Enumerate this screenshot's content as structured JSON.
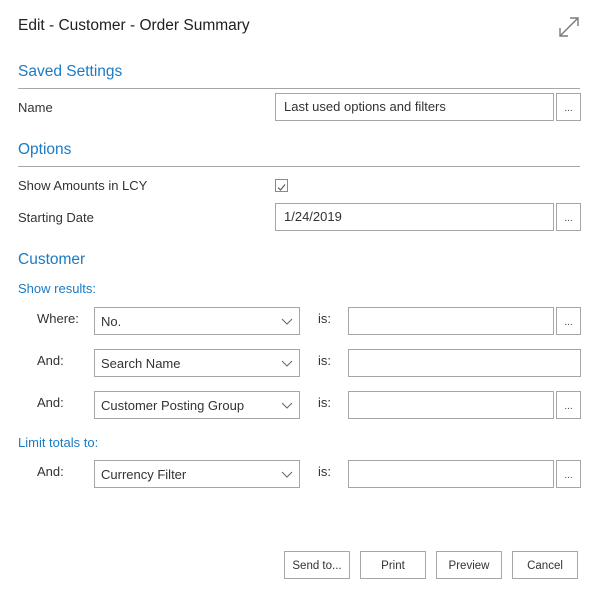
{
  "window": {
    "title": "Edit - Customer - Order Summary",
    "expand_icon": "expand-diagonal-arrows"
  },
  "saved_settings": {
    "heading": "Saved Settings",
    "name_label": "Name",
    "name_value": "Last used options and filters",
    "lookup_label": "..."
  },
  "options": {
    "heading": "Options",
    "show_amounts_label": "Show Amounts in LCY",
    "show_amounts_checked": true,
    "starting_date_label": "Starting Date",
    "starting_date_value": "1/24/2019",
    "lookup_label": "..."
  },
  "customer": {
    "heading": "Customer",
    "show_results_label": "Show results:",
    "filters": [
      {
        "prefix": "Where:",
        "field": "No.",
        "is_label": "is:",
        "value": "",
        "has_lookup": true,
        "lookup_label": "..."
      },
      {
        "prefix": "And:",
        "field": "Search Name",
        "is_label": "is:",
        "value": "",
        "has_lookup": false
      },
      {
        "prefix": "And:",
        "field": "Customer Posting Group",
        "is_label": "is:",
        "value": "",
        "has_lookup": true,
        "lookup_label": "..."
      }
    ],
    "limit_totals_label": "Limit totals to:",
    "limit_filters": [
      {
        "prefix": "And:",
        "field": "Currency Filter",
        "is_label": "is:",
        "value": "",
        "has_lookup": true,
        "lookup_label": "..."
      }
    ]
  },
  "footer": {
    "buttons": [
      "Send to...",
      "Print",
      "Preview",
      "Cancel"
    ]
  },
  "colors": {
    "accent": "#1a7bc4",
    "border": "#a6a6a6",
    "text": "#333333"
  }
}
